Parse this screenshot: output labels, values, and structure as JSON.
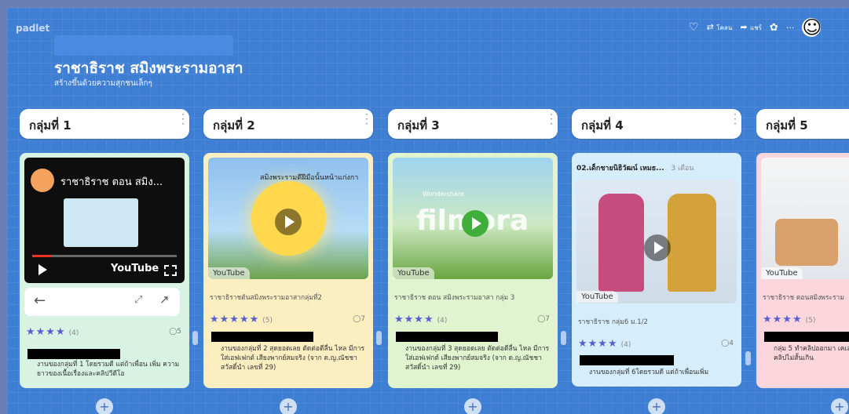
{
  "app": {
    "brand": "padlet"
  },
  "toolbar": {
    "heart": "♡",
    "remake_icon": "⇄",
    "remake": "โคลน",
    "share_icon": "➦",
    "share": "แชร์",
    "settings": "✿",
    "more": "···",
    "avatar": "☺"
  },
  "board": {
    "title": "ราชาธิราช สมิงพระรามอาสา",
    "subtitle": "สร้างขึ้นด้วยความสุกชนเล็กๆ"
  },
  "columns": [
    {
      "label": "กลุ่มที่ 1",
      "video_title": "ราชาธิราช ตอน สมิง...",
      "youtube": "YouTube",
      "stars": "★★★★",
      "rating_count": "(4)",
      "comments": "◯5",
      "body": "งานของกลุ่มที่ 1 โดยรวมดี แต่ถ้าเพื่อน เพิ่ม ความยาวของเนื้อเรื่องและคลิปวีดีโอ"
    },
    {
      "label": "กลุ่มที่ 2",
      "youtube": "YouTube",
      "overlay": "สมิงพระรามดีฝีมือนั้นหน้าแก่งกา",
      "caption": "ราชาธิราชต้นสมิงพระรามอาสากลุ่มที่2",
      "stars": "★★★★★",
      "rating_count": "(5)",
      "comments": "◯7",
      "body": "งานของกลุ่มที่ 2 สุดยอดเลย ตัดต่อดีลื่น ไหล มีการใส่เอฟเฟกต์ เสียงพากย์สมจริง (จาก ด.ญ.ณัชชา สวัสดิ์นำ เลขที่ 29)"
    },
    {
      "label": "กลุ่มที่ 3",
      "youtube": "YouTube",
      "watermark": "filmora",
      "wondershare": "Wondershare",
      "caption": "ราชาธิราช ตอน สมิงพระรามอาสา กลุ่ม 3",
      "stars": "★★★★",
      "rating_count": "(4)",
      "comments": "◯7",
      "body": "งานของกลุ่มที่ 3 สุดยอดเลย ตัดต่อดีลื่น ไหล มีการใส่เอฟเฟกต์ เสียงพากย์สมจริง (จาก ด.ญ.ณัชชา สวัสดิ์นำ เลขที่ 29)"
    },
    {
      "label": "กลุ่มที่ 4",
      "pinned": "02.เด็กชายนิธิวัฒน์ เหมธ...",
      "pinned_time": "3 เดือน",
      "youtube": "YouTube",
      "caption": "ราชาธิราช กลุ่ม6 ม.1/2",
      "stars": "★★★★",
      "rating_count": "(4)",
      "comments": "◯4",
      "body": "งานของกลุ่มที่ 6โดยรวมดี แต่ถ้าเพื่อนเพิ่ม"
    },
    {
      "label": "กลุ่มที่ 5",
      "youtube": "YouTube",
      "caption": "ราชาธิราช ตอนสมิงพระราม",
      "stars": "★★★★",
      "rating_count": "(5)",
      "body": "กลุ่ม 5 ทำคลิปออกมา เคเลย มีภาพประกอบ สมจริง คลิปไม่สั้นเกิน"
    }
  ],
  "add_label": "+",
  "colors": {
    "board": "#3f7fd3",
    "accent": "#5a5fd0"
  }
}
